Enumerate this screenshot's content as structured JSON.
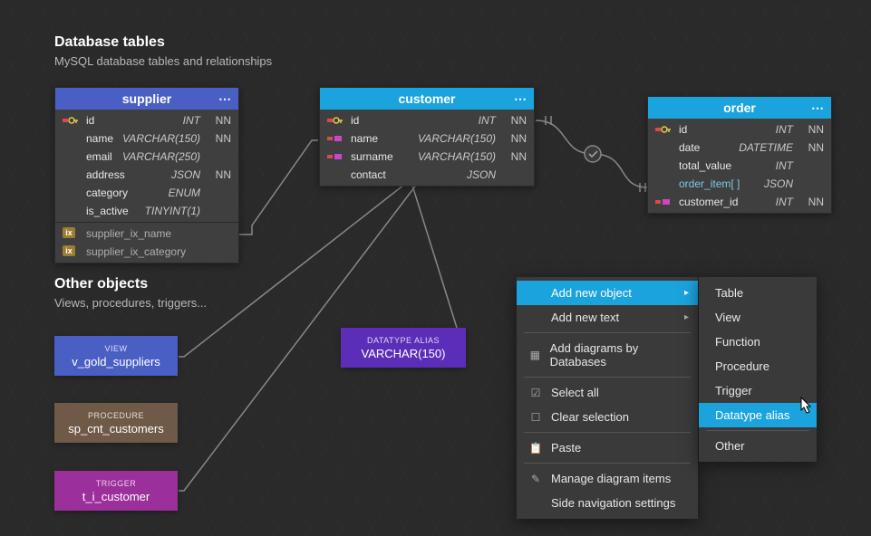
{
  "sections": {
    "tables": {
      "title": "Database tables",
      "sub": "MySQL database tables and relationships"
    },
    "other": {
      "title": "Other objects",
      "sub": "Views, procedures, triggers..."
    }
  },
  "tables": {
    "supplier": {
      "name": "supplier",
      "cols": [
        {
          "name": "id",
          "type": "INT",
          "nn": "NN",
          "pk": true
        },
        {
          "name": "name",
          "type": "VARCHAR(150)",
          "nn": "NN"
        },
        {
          "name": "email",
          "type": "VARCHAR(250)",
          "nn": ""
        },
        {
          "name": "address",
          "type": "JSON",
          "nn": "NN"
        },
        {
          "name": "category",
          "type": "ENUM",
          "nn": ""
        },
        {
          "name": "is_active",
          "type": "TINYINT(1)",
          "nn": ""
        }
      ],
      "ix": [
        "supplier_ix_name",
        "supplier_ix_category"
      ]
    },
    "customer": {
      "name": "customer",
      "cols": [
        {
          "name": "id",
          "type": "INT",
          "nn": "NN",
          "pk": true
        },
        {
          "name": "name",
          "type": "VARCHAR(150)",
          "nn": "NN",
          "fk": true
        },
        {
          "name": "surname",
          "type": "VARCHAR(150)",
          "nn": "NN",
          "fk": true
        },
        {
          "name": "contact",
          "type": "JSON",
          "nn": ""
        }
      ]
    },
    "order": {
      "name": "order",
      "cols": [
        {
          "name": "id",
          "type": "INT",
          "nn": "NN",
          "pk": true
        },
        {
          "name": "date",
          "type": "DATETIME",
          "nn": "NN"
        },
        {
          "name": "total_value",
          "type": "INT",
          "nn": ""
        },
        {
          "name": "order_item[ ]",
          "type": "JSON",
          "nn": "",
          "sub": true
        },
        {
          "name": "customer_id",
          "type": "INT",
          "nn": "NN",
          "fk": true
        }
      ]
    }
  },
  "objects": {
    "view": {
      "label": "VIEW",
      "name": "v_gold_suppliers"
    },
    "proc": {
      "label": "PROCEDURE",
      "name": "sp_cnt_customers"
    },
    "trig": {
      "label": "TRIGGER",
      "name": "t_i_customer"
    },
    "alias": {
      "label": "DATATYPE ALIAS",
      "name": "VARCHAR(150)"
    }
  },
  "menu": {
    "items": [
      {
        "label": "Add new object",
        "arrow": true,
        "active": true
      },
      {
        "label": "Add new text",
        "arrow": true
      },
      {
        "sep": true
      },
      {
        "label": "Add diagrams by Databases",
        "icon": "grid"
      },
      {
        "sep": true
      },
      {
        "label": "Select all",
        "icon": "check"
      },
      {
        "label": "Clear selection",
        "icon": "square"
      },
      {
        "sep": true
      },
      {
        "label": "Paste",
        "icon": "paste"
      },
      {
        "sep": true
      },
      {
        "label": "Manage diagram items",
        "icon": "pencil"
      },
      {
        "label": "Side navigation settings"
      }
    ],
    "sub": [
      "Table",
      "View",
      "Function",
      "Procedure",
      "Trigger",
      "Datatype alias",
      "Other"
    ],
    "sub_active": 5
  }
}
